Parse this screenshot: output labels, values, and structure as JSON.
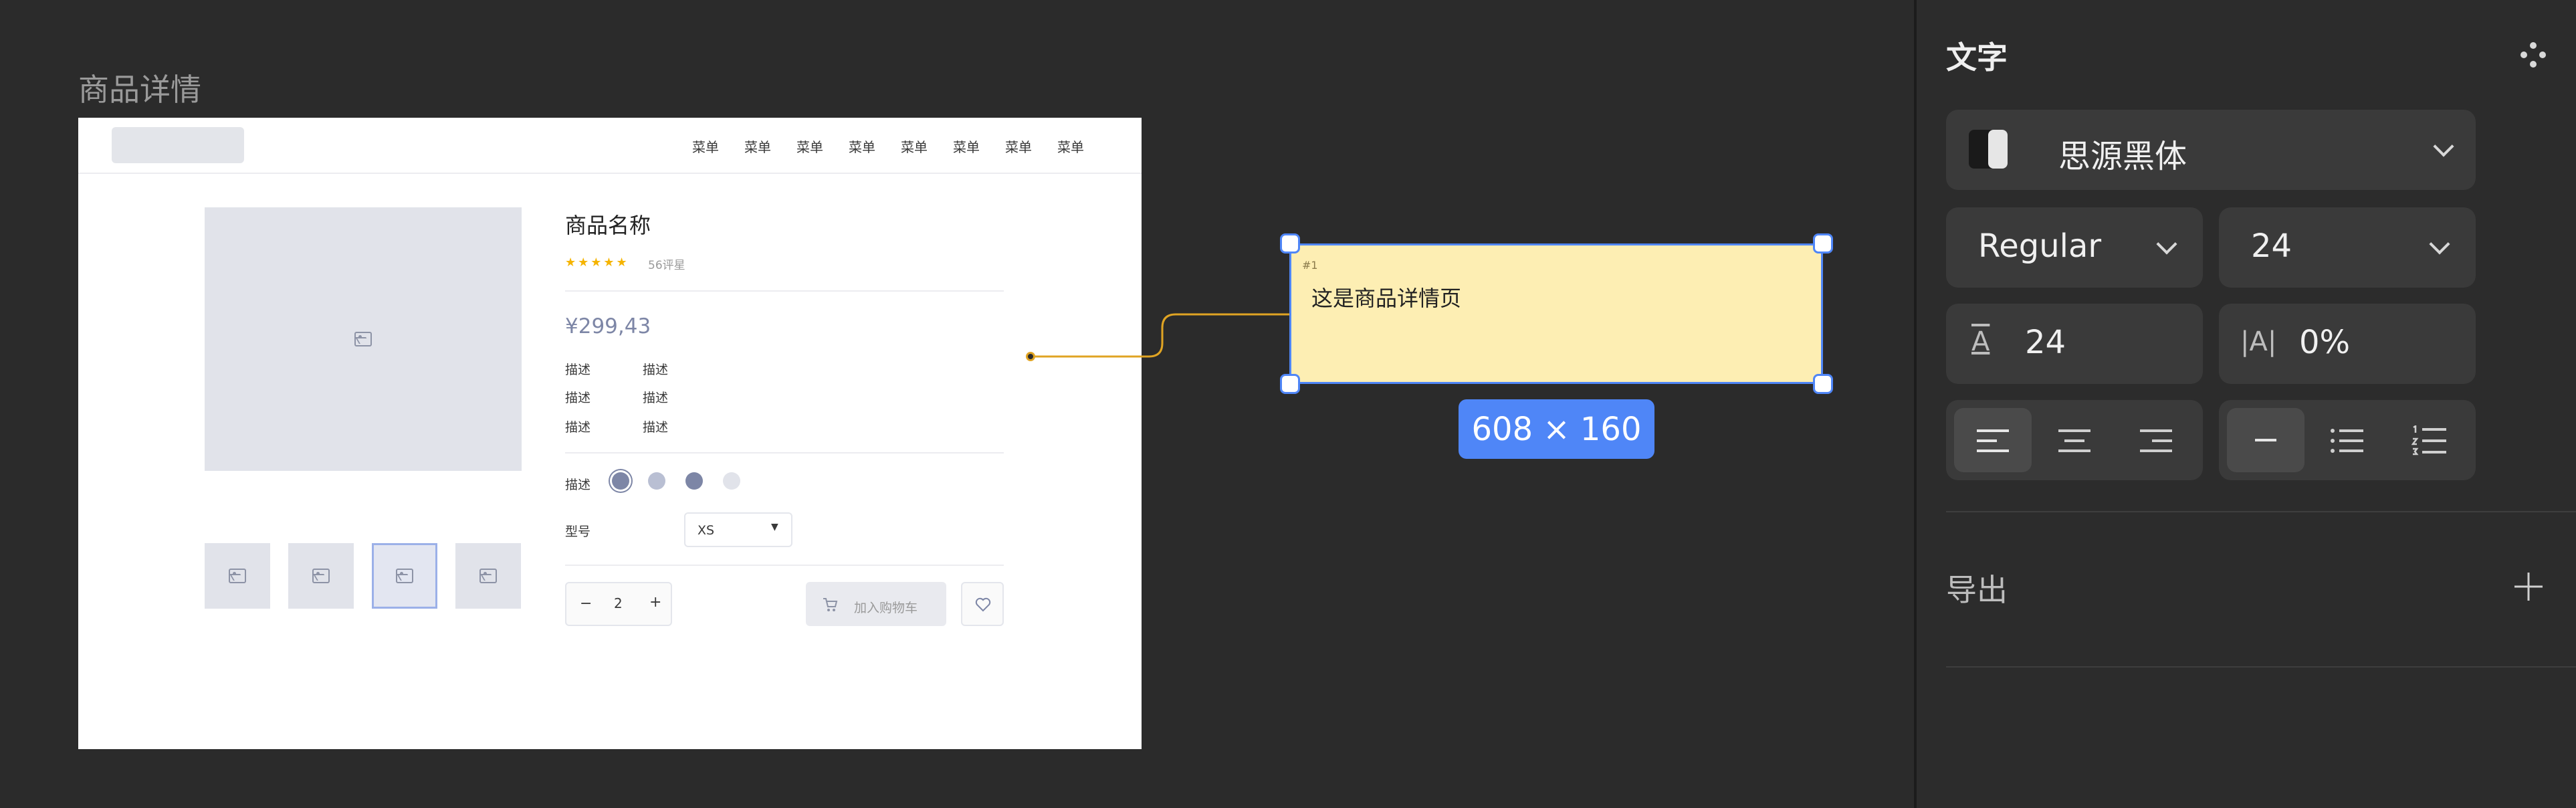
{
  "canvas": {
    "frame_title": "商品详情",
    "wireframe": {
      "menu_items": [
        "菜单",
        "菜单",
        "菜单",
        "菜单",
        "菜单",
        "菜单",
        "菜单",
        "菜单"
      ],
      "product_name": "商品名称",
      "stars": "★★★★★",
      "review_count": "56评星",
      "price": "¥299,43",
      "desc_rows": [
        {
          "label": "描述",
          "value": "描述"
        },
        {
          "label": "描述",
          "value": "描述"
        },
        {
          "label": "描述",
          "value": "描述"
        }
      ],
      "color_label": "描述",
      "model_label": "型号",
      "model_value": "XS",
      "quantity": "2",
      "minus": "−",
      "plus": "+",
      "add_to_cart": "加入购物车"
    },
    "note": {
      "badge": "#1",
      "text": "这是商品详情页",
      "size_label": "608 × 160"
    }
  },
  "inspector": {
    "text_section": {
      "title": "文字",
      "font_family": "思源黑体",
      "font_weight": "Regular",
      "font_size": "24",
      "line_height": "24",
      "letter_spacing": "0%",
      "line_height_icon": "A",
      "letter_spacing_icon": "|A|"
    },
    "export_section": {
      "title": "导出"
    }
  },
  "colors": {
    "accent": "#4f86f7",
    "note_fill": "#fdeeb3",
    "connector": "#e0a423",
    "star": "#f5b400"
  }
}
